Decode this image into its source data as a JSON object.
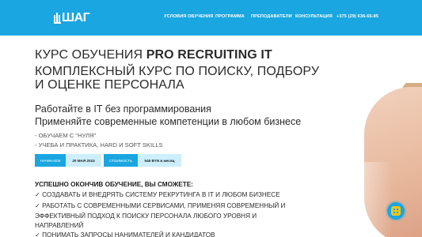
{
  "header": {
    "logo": "ШАГ",
    "nav": [
      {
        "label": "УСЛОВИЯ ОБУЧЕНИЯ"
      },
      {
        "label": "ПРОГРАММА"
      },
      {
        "label": "ПРЕПОДАВАТЕЛИ"
      },
      {
        "label": "КОНСУЛЬТАЦИЯ"
      },
      {
        "label": "+375 (29) 636-65-85"
      }
    ],
    "accent": "#1aa6e1"
  },
  "hero": {
    "title_prefix": "КУРС ОБУЧЕНИЯ ",
    "title_bold": "PRO RECRUITING IT",
    "subtitle": "КОМПЛЕКСНЫЙ КУРС ПО ПОИСКУ, ПОДБОРУ И ОЦЕНКЕ ПЕРСОНАЛА",
    "lead_1": "Работайте в IT без программирования",
    "lead_2": "Применяйте современные компетенции в любом бизнесе",
    "point_1": "- ОБУЧАЕМ С \"НУЛЯ\"",
    "point_2": "- УЧЕБА И ПРАКТИКА, HARD И SOFT SKILLS"
  },
  "info": {
    "start_label": "НАЧИНАЕМ",
    "start_value": "20 МАЯ 2024",
    "price_label": "СТОИМОСТЬ",
    "price_value": "545 BYN в месяц"
  },
  "outcomes": {
    "heading": "УСПЕШНО ОКОНЧИВ ОБУЧЕНИЕ, ВЫ СМОЖЕТЕ:",
    "items": [
      "✓ СОЗДАВАТЬ И ВНЕДРЯТЬ СИСТЕМУ РЕКРУТИНГА В IT И ЛЮБОМ БИЗНЕСЕ",
      "✓ РАБОТАТЬ С СОВРЕМЕННЫМИ СЕРВИСАМИ, ПРИМЕНЯЯ СОВРЕМЕННЫЙ И",
      "ЭФФЕКТИВНЫЙ ПОДХОД К ПОИСКУ ПЕРСОНАЛА ЛЮБОГО УРОВНЯ И",
      "НАПРАВЛЕНИЙ",
      "✓ ПОНИМАТЬ ЗАПРОСЫ НАНИМАТЕЛЕЙ И КАНДИДАТОВ"
    ]
  },
  "chat": {
    "icon": "chat-icon",
    "color": "#f2c318"
  }
}
